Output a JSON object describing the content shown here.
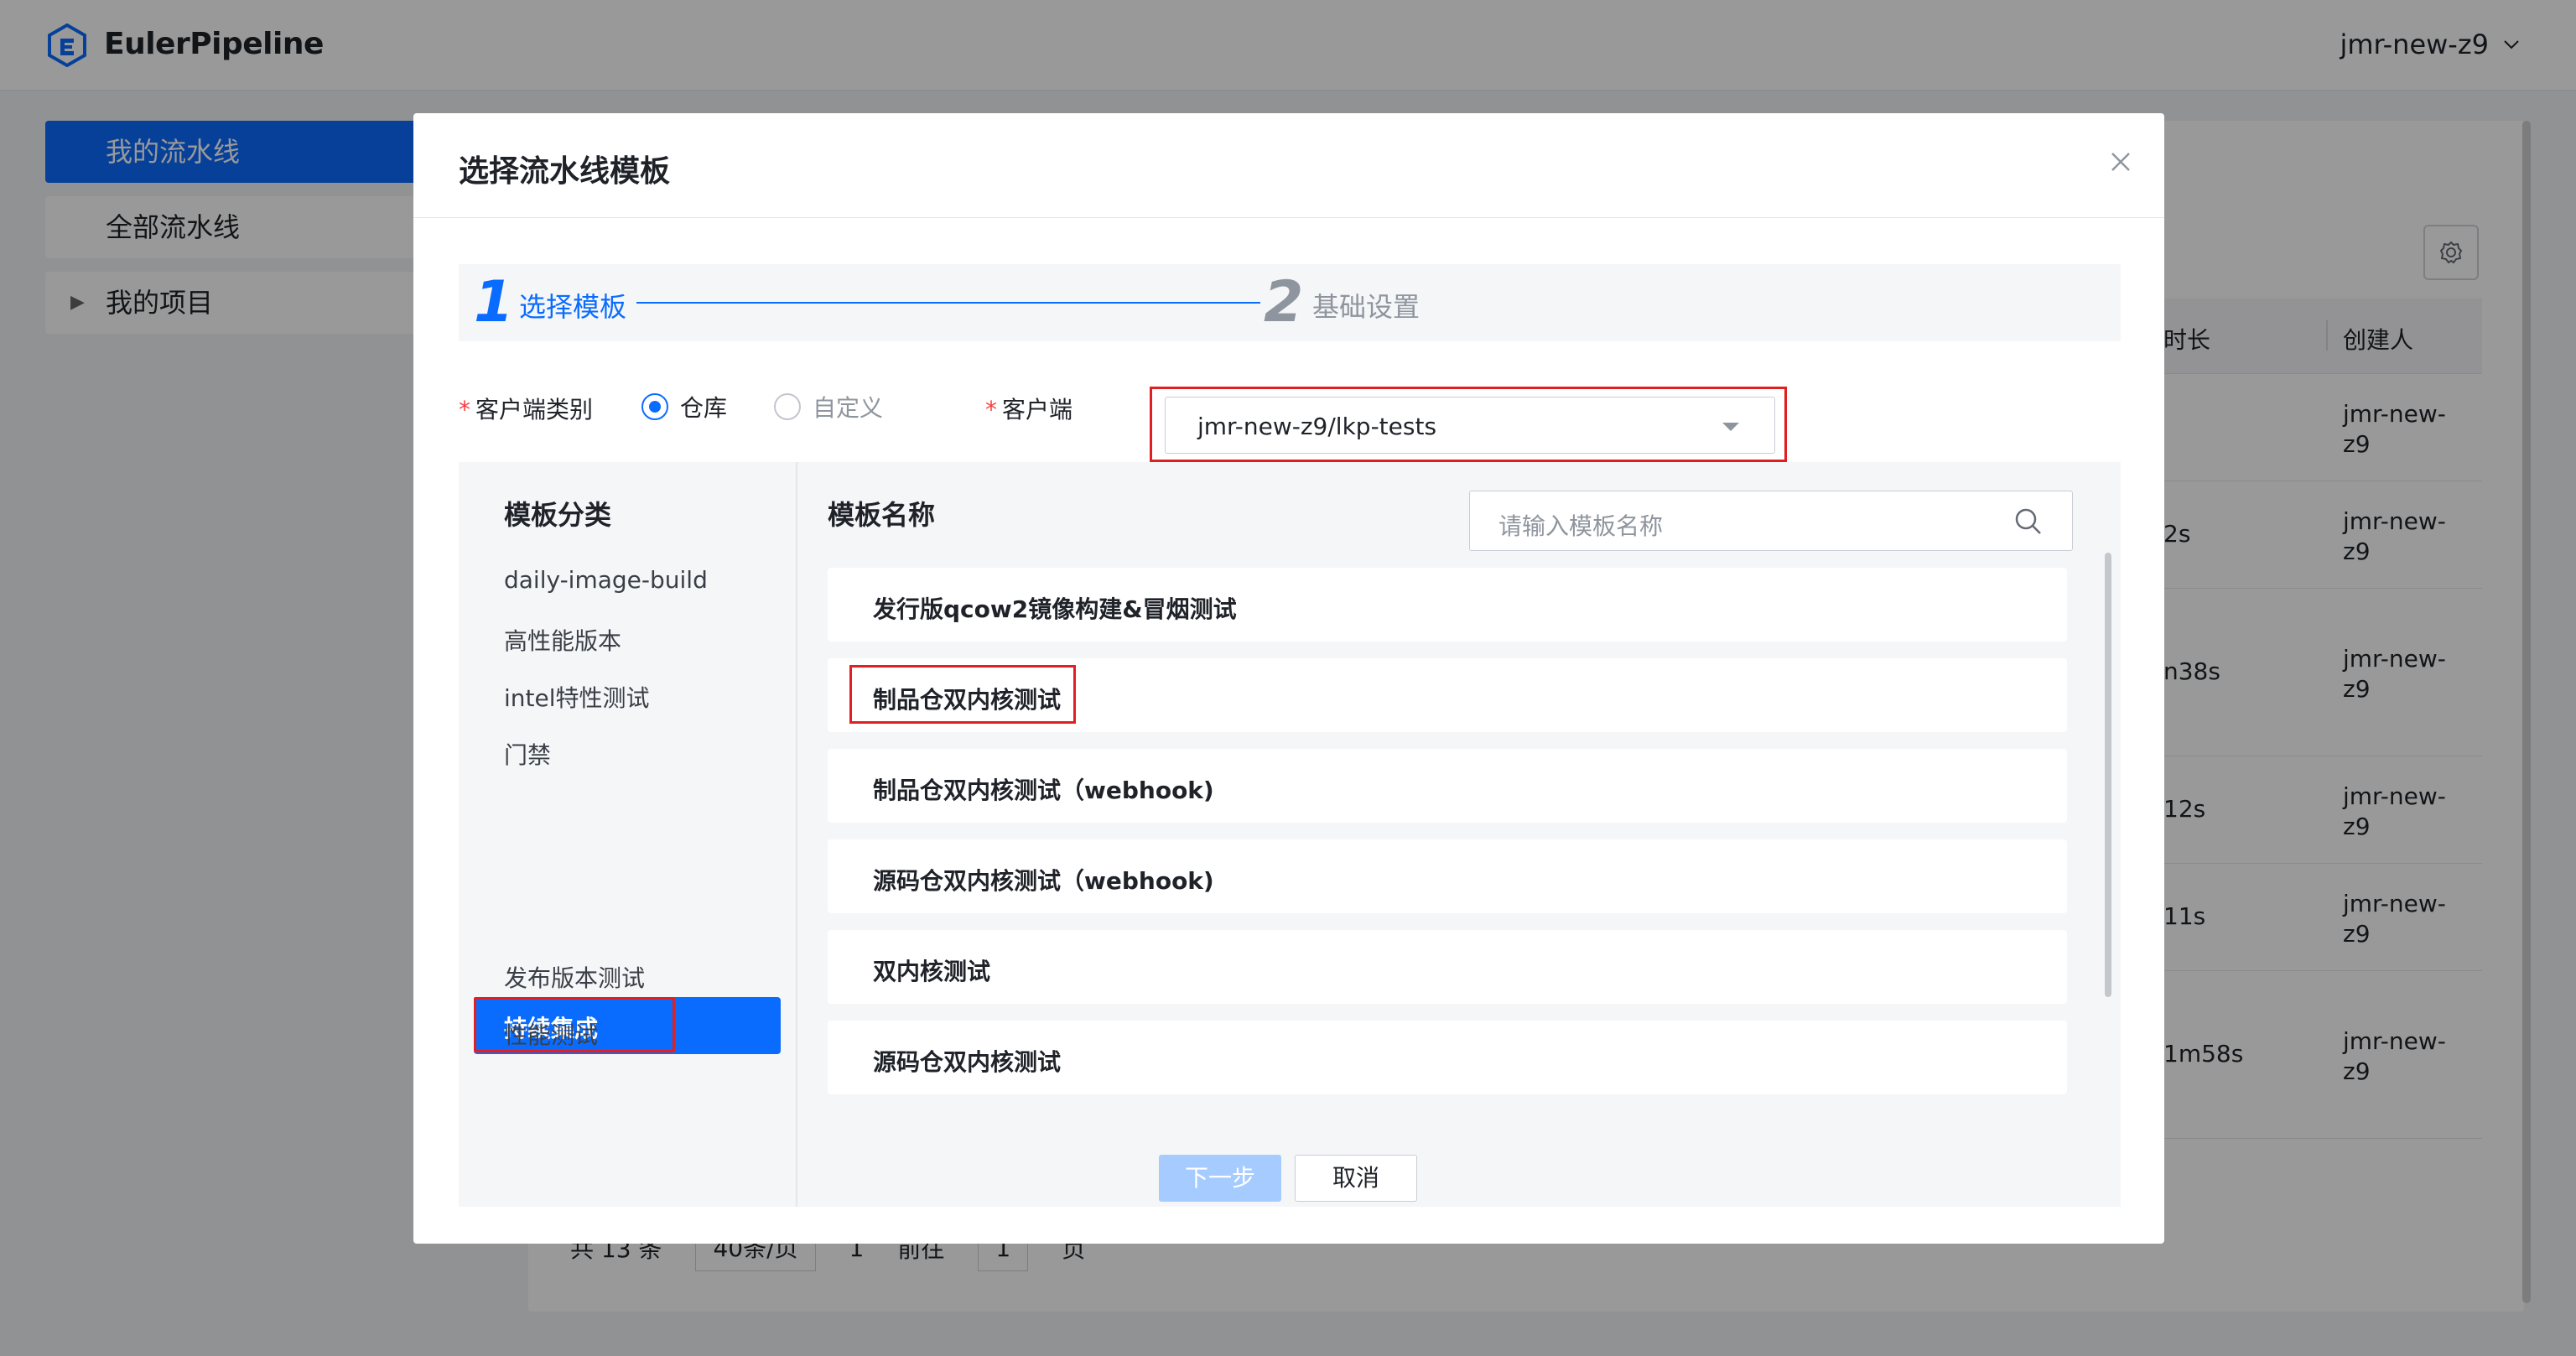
{
  "header": {
    "brand": "EulerPipeline",
    "user": "jmr-new-z9"
  },
  "nav": {
    "items": [
      {
        "label": "我的流水线"
      },
      {
        "label": "全部流水线"
      },
      {
        "label": "我的项目"
      }
    ]
  },
  "background_table": {
    "col_duration": "时长",
    "col_creator": "创建人",
    "rows": [
      {
        "duration": "",
        "creator": "jmr-new-z9"
      },
      {
        "duration": "2s",
        "creator": "jmr-new-z9"
      },
      {
        "duration": "n38s",
        "creator": "jmr-new-z9"
      },
      {
        "duration": "12s",
        "creator": "jmr-new-z9"
      },
      {
        "duration": "11s",
        "creator": "jmr-new-z9"
      },
      {
        "duration": "1m58s",
        "creator": "jmr-new-z9"
      }
    ]
  },
  "pager": {
    "total": "共 13 条",
    "page_size": "40条/页",
    "page": "1",
    "goto": "前往",
    "goto_value": "1",
    "page_unit": "页"
  },
  "modal": {
    "title": "选择流水线模板",
    "steps": [
      {
        "num": "1",
        "label": "选择模板",
        "active": true
      },
      {
        "num": "2",
        "label": "基础设置",
        "active": false
      }
    ],
    "client_type_label": "客户端类别",
    "client_type_options": [
      {
        "label": "仓库",
        "selected": true
      },
      {
        "label": "自定义",
        "selected": false
      }
    ],
    "client_label": "客户端",
    "client_value": "jmr-new-z9/lkp-tests",
    "category_title": "模板分类",
    "categories": [
      "daily-image-build",
      "高性能版本",
      "intel特性测试",
      "门禁",
      "持续集成",
      "发布版本测试",
      "性能测试"
    ],
    "selected_category": "持续集成",
    "template_title": "模板名称",
    "search_placeholder": "请输入模板名称",
    "templates": [
      "发行版qcow2镜像构建&冒烟测试",
      "制品仓双内核测试",
      "制品仓双内核测试（webhook)",
      "源码仓双内核测试（webhook)",
      "双内核测试",
      "源码仓双内核测试"
    ],
    "next_label": "下一步",
    "cancel_label": "取消"
  },
  "colors": {
    "accent": "#0a6cff",
    "highlight": "#e02020"
  }
}
